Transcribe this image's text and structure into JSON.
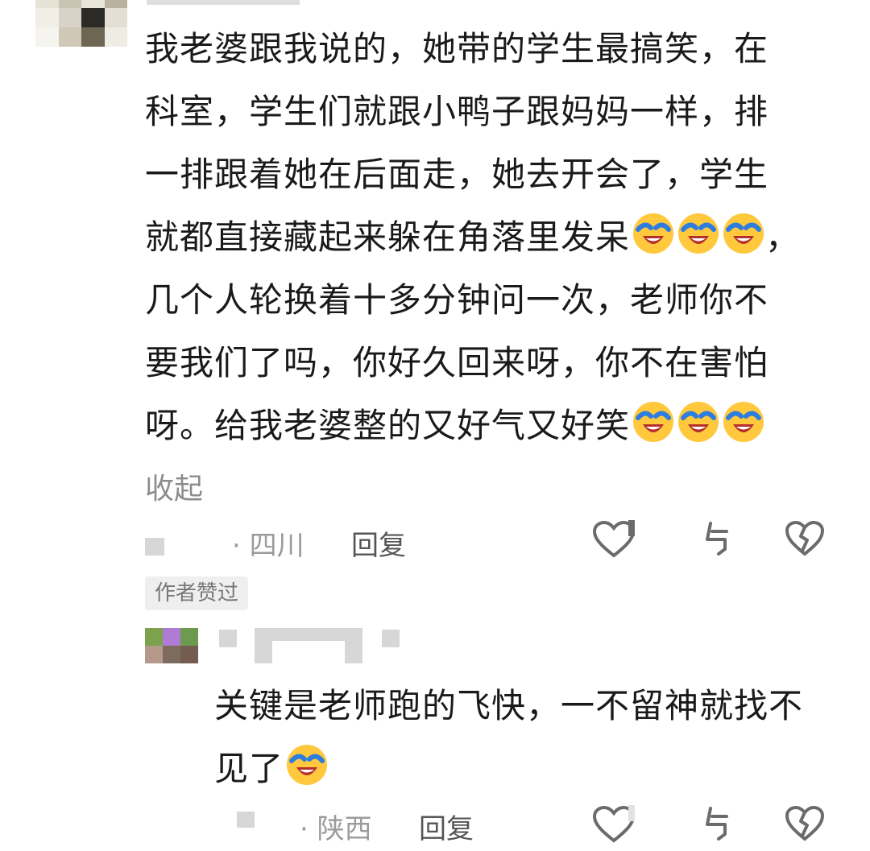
{
  "comment1": {
    "paragraph_lines": [
      "我老婆跟我说的，她带的学生最搞笑，在",
      "科室，学生们就跟小鸭子跟妈妈一样，排",
      "一排跟着她在后面走，她去开会了，学生",
      "就都直接藏起来躲在角落里发呆",
      "，",
      "几个人轮换着十多分钟问一次，老师你不",
      "要我们了吗，你好久回来呀，你不在害怕",
      "呀。给我老婆整的又好气又好笑"
    ],
    "collapse_label": "收起",
    "location": "· 四川",
    "reply_label": "回复",
    "author_badge": "作者赞过"
  },
  "comment2": {
    "paragraph_lines": [
      "关键是老师跑的飞快，一不留神就找不",
      "见了"
    ],
    "location": "· 陕西",
    "reply_label": "回复"
  },
  "icons": {
    "emoji": "laughing-crying-emoji",
    "like": "heart-outline-icon",
    "share": "share-icon",
    "dislike": "broken-heart-icon"
  },
  "colors": {
    "text": "#1a1a1a",
    "meta": "#9b9b9b",
    "badge_bg": "#efefef",
    "emoji_face": "#FFC83D"
  }
}
